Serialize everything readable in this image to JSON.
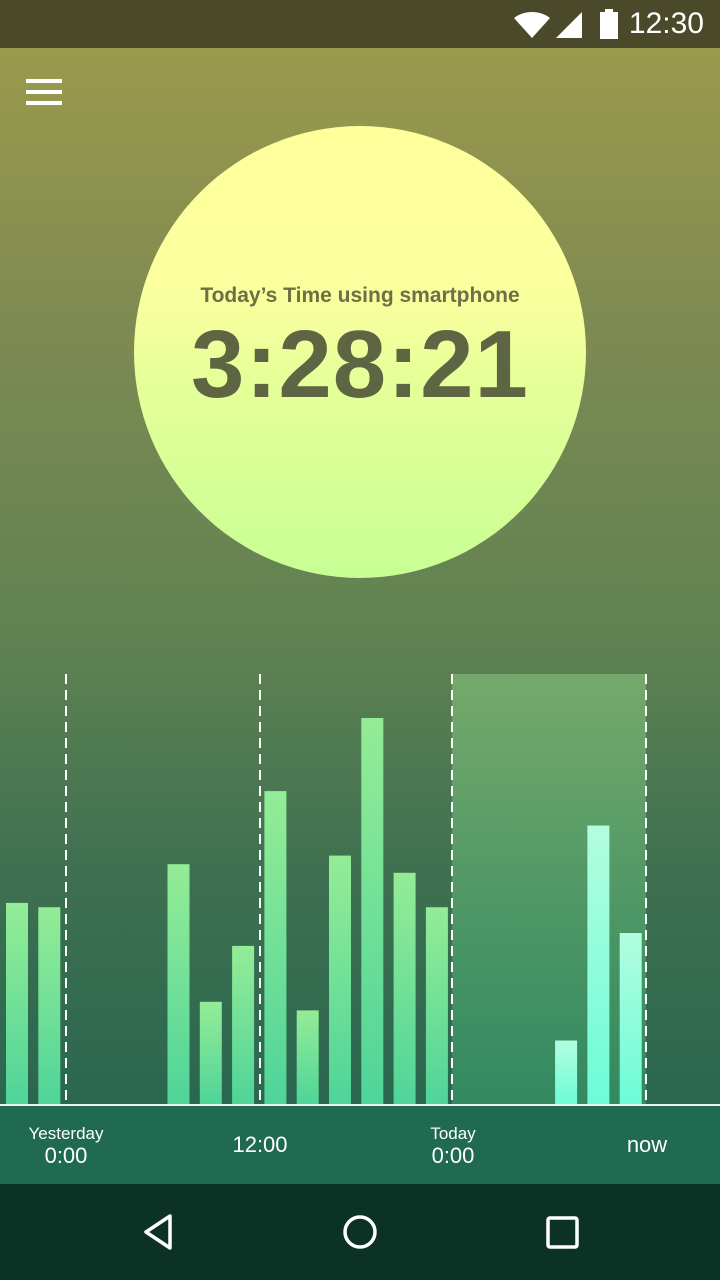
{
  "status_bar": {
    "time": "12:30"
  },
  "usage": {
    "label": "Today’s Time using smartphone",
    "duration": "3:28:21"
  },
  "chart_data": {
    "type": "bar",
    "x_ticks": [
      {
        "small": "Yesterday",
        "main": "0:00"
      },
      {
        "small": "",
        "main": "12:00"
      },
      {
        "small": "Today",
        "main": "0:00"
      },
      {
        "small": "",
        "main": "now"
      }
    ],
    "values": [
      0.47,
      0.46,
      0,
      0,
      0,
      0.56,
      0.24,
      0.37,
      0.73,
      0.22,
      0.58,
      0.9,
      0.54,
      0.46,
      0,
      0,
      0,
      0.15,
      0.65,
      0.4
    ],
    "highlight_from_index": 14,
    "grid": "dashed vertical lines at tick boundaries"
  },
  "colors": {
    "bar_top": "#94ec96",
    "bar_bottom": "#4fd499",
    "highlight_bar_top": "#b3fde0",
    "highlight_bar_bottom": "#6cfcd6",
    "highlight_region": "#6ea86e"
  },
  "nav": {
    "back_icon": "back-triangle",
    "home_icon": "home-circle",
    "recents_icon": "recents-square"
  }
}
